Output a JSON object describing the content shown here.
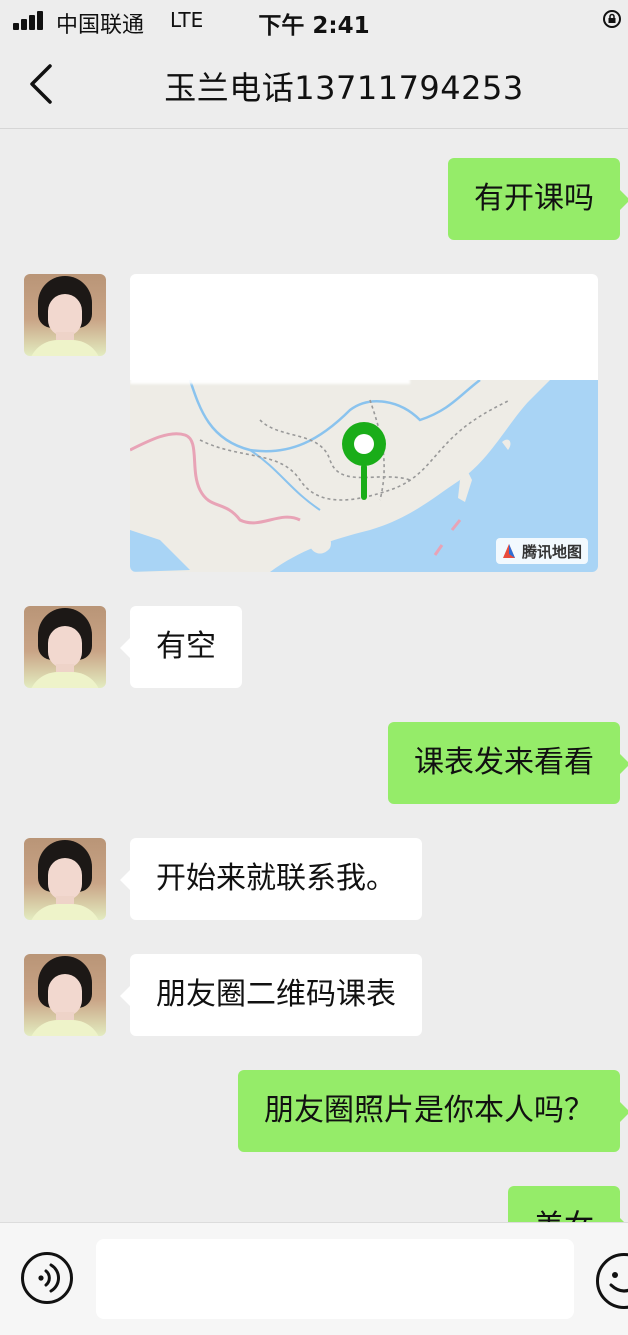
{
  "status_bar": {
    "carrier": "中国联通",
    "network": "LTE",
    "time": "下午 2:41"
  },
  "nav": {
    "title": "玉兰电话13711794253"
  },
  "messages": [
    {
      "side": "right",
      "text": "有开课吗"
    },
    {
      "side": "left",
      "type": "location",
      "title": "",
      "address": "",
      "map_brand": "腾讯地图"
    },
    {
      "side": "left",
      "text": "有空"
    },
    {
      "side": "right",
      "text": "课表发来看看"
    },
    {
      "side": "left",
      "text": "开始来就联系我。"
    },
    {
      "side": "left",
      "text": "朋友圈二维码课表"
    },
    {
      "side": "right",
      "text": "朋友圈照片是你本人吗？"
    },
    {
      "side": "right",
      "text": "美女"
    }
  ],
  "input": {
    "placeholder": "",
    "value": ""
  },
  "colors": {
    "background": "#ededed",
    "outgoing_bubble": "#95ec69",
    "incoming_bubble": "#ffffff",
    "map_pin": "#1aad19"
  }
}
